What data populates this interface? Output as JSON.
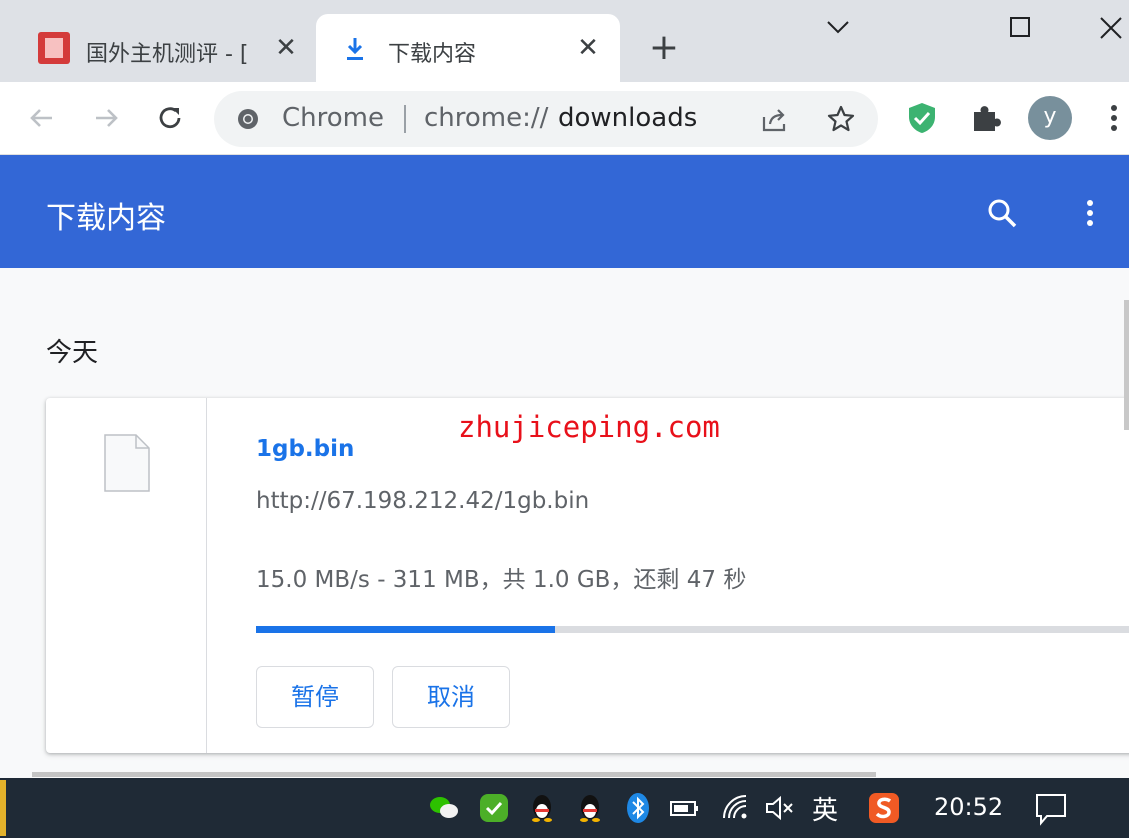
{
  "browser": {
    "tabs": [
      {
        "title": "国外主机测评 - [",
        "close": "✕"
      },
      {
        "title": "下载内容",
        "close": "✕"
      }
    ],
    "new_tab": "+",
    "omnibox": {
      "site_chip": "Chrome",
      "url_scheme": "chrome://",
      "url_host": "downloads"
    },
    "profile_initial": "y"
  },
  "downloads_page": {
    "header_title": "下载内容",
    "date_group": "今天",
    "item": {
      "filename": "1gb.bin",
      "url": "http://67.198.212.42/1gb.bin",
      "status": "15.0 MB/s - 311 MB，共 1.0 GB，还剩 47 秒",
      "progress": 0.34,
      "pause_label": "暂停",
      "cancel_label": "取消"
    },
    "watermark": "zhujiceping.com"
  },
  "taskbar": {
    "ime_label": "英",
    "clock": "20:52"
  },
  "colors": {
    "accent": "#1a73e8",
    "header": "#3367d6",
    "watermark": "#e8101a"
  }
}
